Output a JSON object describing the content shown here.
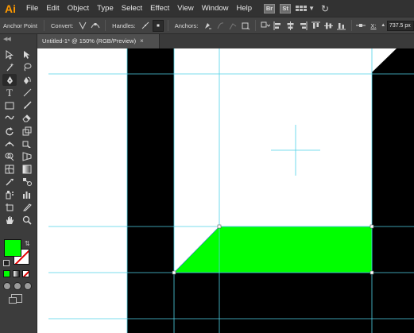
{
  "app": {
    "logo": "Ai"
  },
  "menu": {
    "items": [
      "File",
      "Edit",
      "Object",
      "Type",
      "Select",
      "Effect",
      "View",
      "Window",
      "Help"
    ],
    "badges": [
      "Br",
      "St"
    ],
    "icons": [
      "arrange-documents-icon",
      "sync-icon"
    ]
  },
  "control_bar": {
    "tool_name": "Anchor Point",
    "convert_label": "Convert:",
    "handles_label": "Handles:",
    "anchors_label": "Anchors:",
    "x_label": "X:",
    "x_value": "737.5 px"
  },
  "document": {
    "tab_title": "Untitled-1* @ 150% (RGB/Preview)",
    "close_glyph": "×"
  },
  "colors": {
    "fill": "#00ff00",
    "stroke": "#ffffff",
    "guides": "#4fd2e8",
    "shape": "#000000",
    "selection": "#3b6df5"
  },
  "toolbar": {
    "tools": [
      [
        "selection-tool",
        "direct-selection-tool"
      ],
      [
        "magic-wand-tool",
        "lasso-tool"
      ],
      [
        "pen-tool",
        "curvature-tool"
      ],
      [
        "type-tool",
        "line-segment-tool"
      ],
      [
        "rectangle-tool",
        "paintbrush-tool"
      ],
      [
        "shaper-tool",
        "eraser-tool"
      ],
      [
        "rotate-tool",
        "scale-tool"
      ],
      [
        "width-tool",
        "free-transform-tool"
      ],
      [
        "shape-builder-tool",
        "perspective-grid-tool"
      ],
      [
        "mesh-tool",
        "gradient-tool"
      ],
      [
        "eyedropper-tool",
        "blend-tool"
      ],
      [
        "symbol-sprayer-tool",
        "column-graph-tool"
      ],
      [
        "artboard-tool",
        "slice-tool"
      ],
      [
        "hand-tool",
        "zoom-tool"
      ]
    ]
  }
}
